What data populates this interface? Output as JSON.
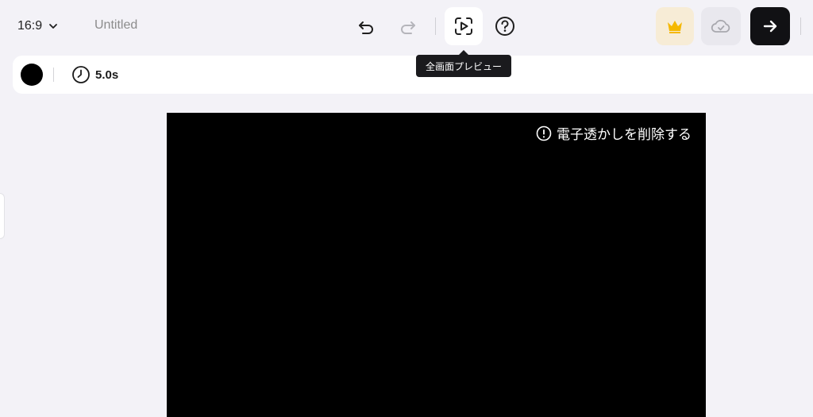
{
  "header": {
    "aspect_ratio": "16:9",
    "title": "Untitled",
    "icons": {
      "ratio_dropdown": "chevron-down-icon",
      "undo": "undo-icon",
      "redo": "redo-icon",
      "preview": "fullscreen-preview-icon",
      "help": "help-icon",
      "premium": "crown-icon",
      "save": "cloud-icon",
      "next": "arrow-right-icon"
    },
    "colors": {
      "premium_bg": "#f7ecd6",
      "premium_icon": "#f5b800",
      "next_bg": "#111114"
    }
  },
  "tooltip": {
    "text": "全画面プレビュー"
  },
  "toolbar": {
    "background_color": "#000000",
    "duration": "5.0s",
    "duration_icon": "clock-icon"
  },
  "canvas": {
    "background_color": "#000000",
    "watermark_text": "電子透かしを削除する",
    "watermark_icon": "info-icon"
  }
}
